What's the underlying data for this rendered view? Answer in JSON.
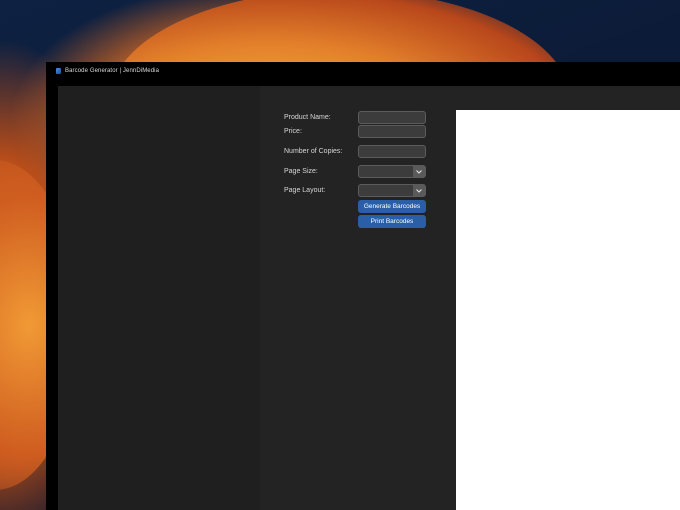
{
  "window": {
    "title": "Barcode Generator | JennDiMedia"
  },
  "form": {
    "product_name_label": "Product Name:",
    "price_label": "Price:",
    "copies_label": "Number of Copies:",
    "page_size_label": "Page Size:",
    "page_layout_label": "Page Layout:",
    "product_name_value": "",
    "price_value": "",
    "copies_value": "",
    "page_size_value": "",
    "page_layout_value": ""
  },
  "buttons": {
    "generate_label": "Generate Barcodes",
    "print_label": "Print Barcodes"
  },
  "icons": {
    "app": "barcode-app-icon",
    "dropdown": "chevron-down-icon"
  },
  "colors": {
    "button": "#2a5fa8",
    "panel": "#232323",
    "sidebar": "#1f1f1f",
    "preview": "#ffffff"
  }
}
